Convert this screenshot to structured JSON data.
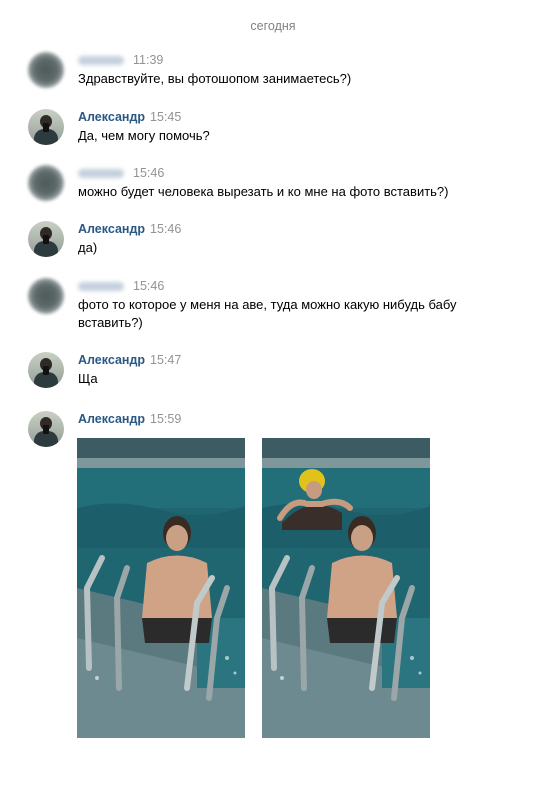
{
  "date_separator": "сегодня",
  "messages": [
    {
      "author": "",
      "time": "11:39",
      "text": "Здравствуйте, вы фотошопом занимаетесь?)",
      "avatar": "blurred-avatar"
    },
    {
      "author": "Александр",
      "time": "15:45",
      "text": "Да, чем могу помочь?",
      "avatar": "alexander-avatar"
    },
    {
      "author": "",
      "time": "15:46",
      "text": "можно будет человека вырезать и ко мне на фото вставить?)",
      "avatar": "blurred-avatar"
    },
    {
      "author": "Александр",
      "time": "15:46",
      "text": "да)",
      "avatar": "alexander-avatar"
    },
    {
      "author": "",
      "time": "15:46",
      "text": "фото то которое у меня на аве, туда можно какую нибудь бабу вставить?)",
      "avatar": "blurred-avatar"
    },
    {
      "author": "Александр",
      "time": "15:47",
      "text": "Ща",
      "avatar": "alexander-avatar"
    },
    {
      "author": "Александр",
      "time": "15:59",
      "text": "",
      "avatar": "alexander-avatar",
      "attachments": [
        "pool-photo-original",
        "pool-photo-edited"
      ]
    }
  ],
  "colors": {
    "author": "#2a5885",
    "time": "#939393",
    "separator": "#828282",
    "water": "#1e6a74",
    "tiles": "#4e6e76"
  }
}
